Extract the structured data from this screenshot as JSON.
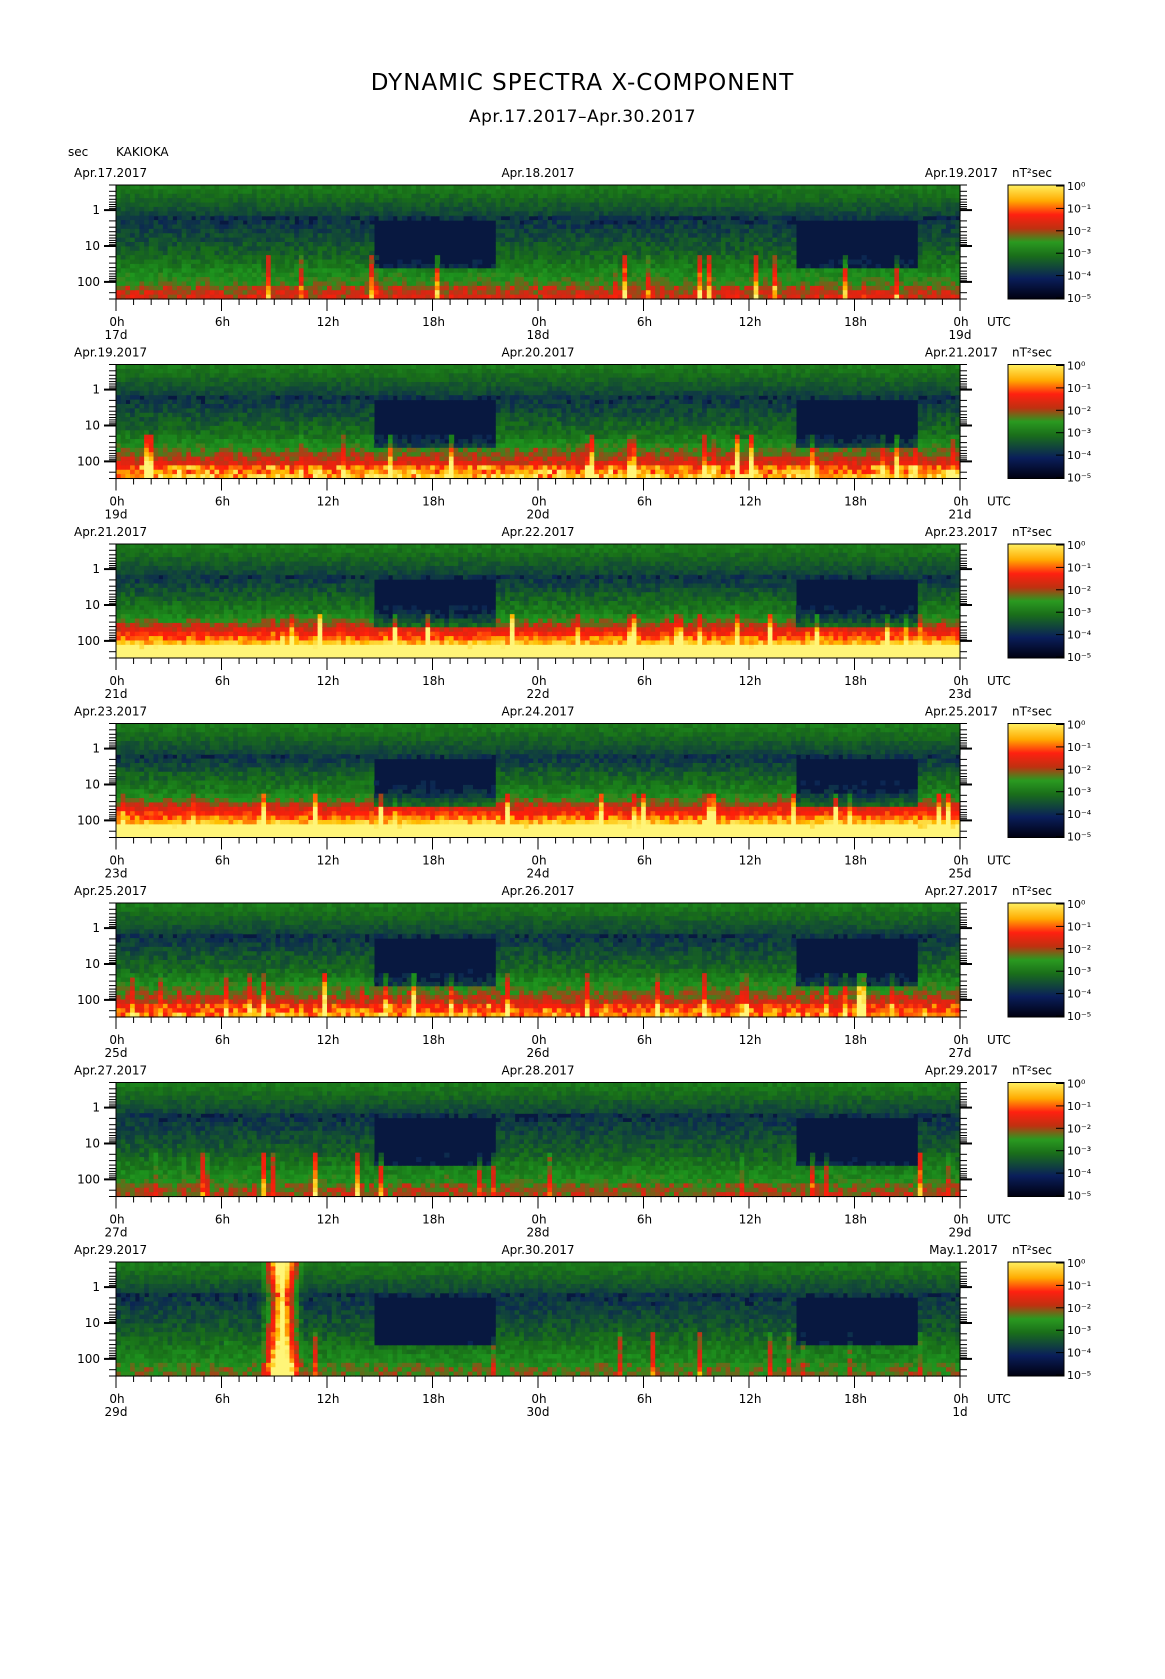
{
  "title": "DYNAMIC SPECTRA X-COMPONENT",
  "subtitle": "Apr.17.2017–Apr.30.2017",
  "station": "KAKIOKA",
  "y_unit": "sec",
  "x_unit": "UTC",
  "power_unit": "nT²sec",
  "chart_data": {
    "type": "heatmap",
    "y_axis": {
      "label": "sec",
      "ticks": [
        "1",
        "10",
        "100"
      ],
      "scale": "log",
      "range": [
        0.2,
        300
      ],
      "inverted": true
    },
    "x_axis": {
      "label": "UTC",
      "hour_ticks": [
        "0h",
        "6h",
        "12h",
        "18h",
        "0h",
        "6h",
        "12h",
        "18h",
        "0h"
      ],
      "span_hours": 48
    },
    "colorbar": {
      "unit": "nT²sec",
      "tick_labels": [
        "10⁰",
        "10⁻¹",
        "10⁻²",
        "10⁻³",
        "10⁻⁴",
        "10⁻⁵"
      ],
      "range_log10": [
        -5,
        0
      ],
      "colors": [
        "#000010",
        "#0a1e5a",
        "#1d8a1d",
        "#e02010",
        "#ffcc00",
        "#fff060"
      ]
    },
    "panels": [
      {
        "left_date": "Apr.17.2017",
        "mid_date": "Apr.18.2017",
        "right_date": "Apr.19.2017",
        "days": [
          "17d",
          "18d",
          "19d"
        ],
        "activity": 0.8,
        "red_level": 0.25,
        "events": []
      },
      {
        "left_date": "Apr.19.2017",
        "mid_date": "Apr.20.2017",
        "right_date": "Apr.21.2017",
        "days": [
          "19d",
          "20d",
          "21d"
        ],
        "activity": 1.0,
        "red_level": 0.5,
        "events": []
      },
      {
        "left_date": "Apr.21.2017",
        "mid_date": "Apr.22.2017",
        "right_date": "Apr.23.2017",
        "days": [
          "21d",
          "22d",
          "23d"
        ],
        "activity": 1.3,
        "red_level": 0.85,
        "events": []
      },
      {
        "left_date": "Apr.23.2017",
        "mid_date": "Apr.24.2017",
        "right_date": "Apr.25.2017",
        "days": [
          "23d",
          "24d",
          "25d"
        ],
        "activity": 1.35,
        "red_level": 0.8,
        "events": []
      },
      {
        "left_date": "Apr.25.2017",
        "mid_date": "Apr.26.2017",
        "right_date": "Apr.27.2017",
        "days": [
          "25d",
          "26d",
          "27d"
        ],
        "activity": 1.0,
        "red_level": 0.4,
        "events": []
      },
      {
        "left_date": "Apr.27.2017",
        "mid_date": "Apr.28.2017",
        "right_date": "Apr.29.2017",
        "days": [
          "27d",
          "28d",
          "29d"
        ],
        "activity": 0.75,
        "red_level": 0.2,
        "events": []
      },
      {
        "left_date": "Apr.29.2017",
        "mid_date": "Apr.30.2017",
        "right_date": "May.1.2017",
        "days": [
          "29d",
          "30d",
          "1d"
        ],
        "activity": 0.7,
        "red_level": 0.15,
        "events": [
          {
            "hour": 9.3,
            "period_top_sec": 0.2
          }
        ]
      }
    ]
  }
}
